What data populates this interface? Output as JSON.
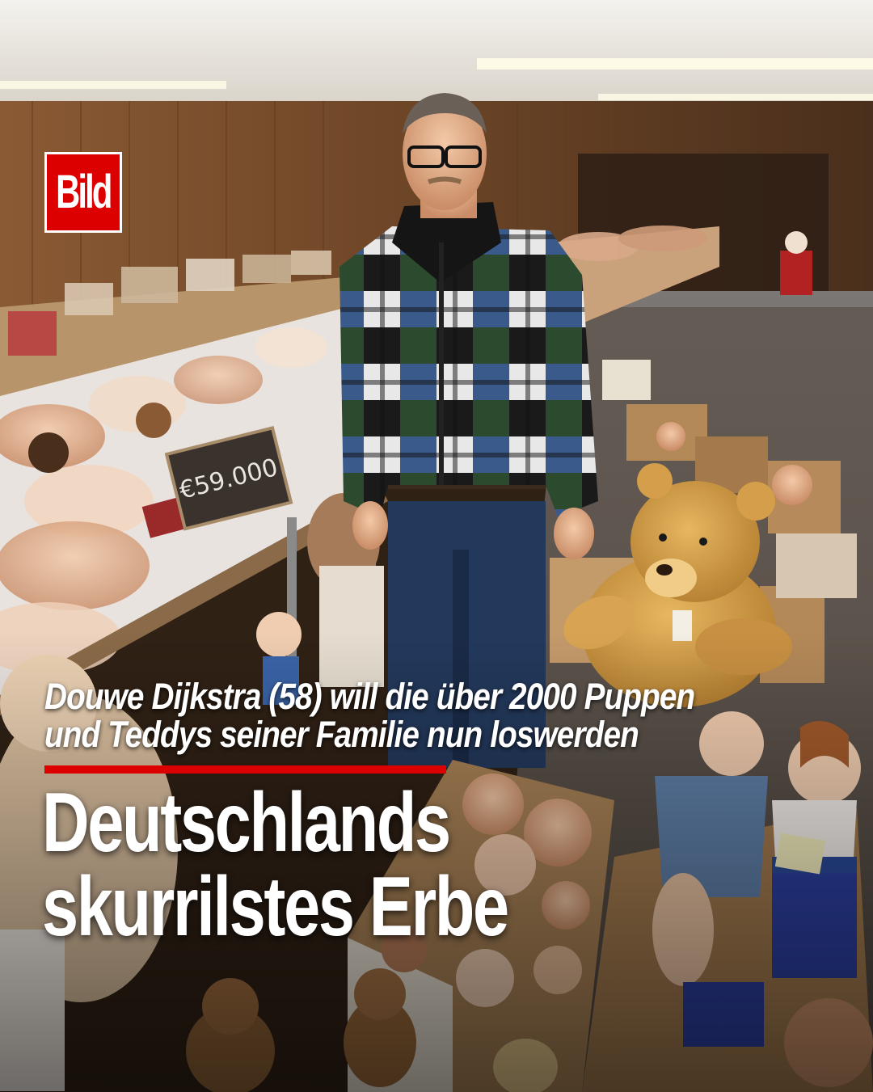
{
  "brand": {
    "logo_text": "Bild",
    "logo_color": "#dd0000",
    "accent_color": "#dd0000"
  },
  "photo": {
    "price_tag": "€59.000"
  },
  "caption": {
    "subline_1": "Douwe Dijkstra (58) will die über 2000 Puppen",
    "subline_2": "und Teddys seiner Familie nun loswerden"
  },
  "headline": {
    "line_1": "Deutschlands",
    "line_2": "skurrilstes Erbe"
  }
}
